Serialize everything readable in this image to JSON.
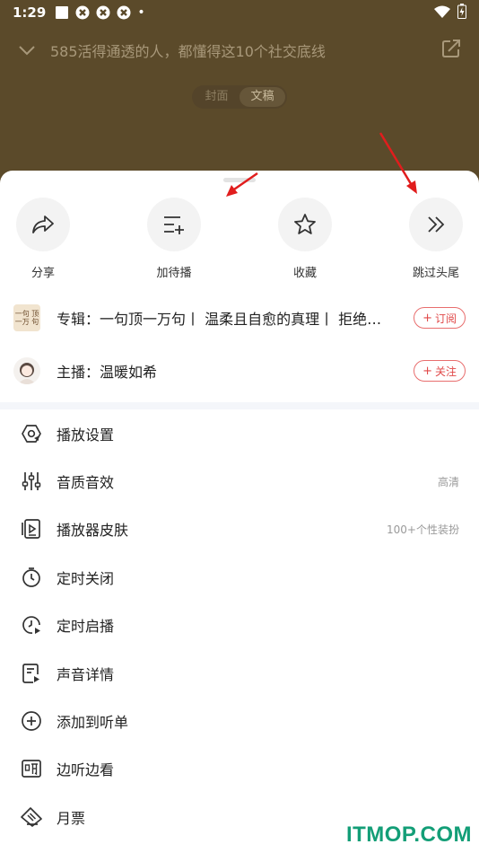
{
  "status_bar": {
    "time": "1:29",
    "dot": "•"
  },
  "header": {
    "title": "585活得通透的人，都懂得这10个社交底线",
    "tabs": [
      {
        "label": "封面"
      },
      {
        "label": "文稿"
      }
    ]
  },
  "quick_actions": [
    {
      "label": "分享",
      "icon": "share-icon"
    },
    {
      "label": "加待播",
      "icon": "add-to-queue-icon"
    },
    {
      "label": "收藏",
      "icon": "star-icon"
    },
    {
      "label": "跳过头尾",
      "icon": "skip-intro-icon"
    }
  ],
  "album": {
    "text": "专辑：一句顶一万句丨 温柔且自愈的真理丨 拒绝…",
    "thumb_text": "一句 顶一万 句",
    "button": {
      "plus": "+",
      "label": "订阅"
    }
  },
  "host": {
    "text": "主播：温暖如希",
    "button": {
      "plus": "+",
      "label": "关注"
    }
  },
  "menu": [
    {
      "label": "播放设置",
      "value": "",
      "icon": "play-settings-icon"
    },
    {
      "label": "音质音效",
      "value": "高清",
      "icon": "equalizer-icon"
    },
    {
      "label": "播放器皮肤",
      "value": "100+个性装扮",
      "icon": "player-skin-icon"
    },
    {
      "label": "定时关闭",
      "value": "",
      "icon": "timer-icon"
    },
    {
      "label": "定时启播",
      "value": "",
      "icon": "timed-start-icon"
    },
    {
      "label": "声音详情",
      "value": "",
      "icon": "audio-detail-icon"
    },
    {
      "label": "添加到听单",
      "value": "",
      "icon": "add-playlist-icon"
    },
    {
      "label": "边听边看",
      "value": "",
      "icon": "listen-read-icon"
    },
    {
      "label": "月票",
      "value": "",
      "icon": "monthly-ticket-icon"
    }
  ],
  "watermark": "ITMOP.COM",
  "colors": {
    "accent_red": "#e04848",
    "header_bg": "#5b4a2a",
    "watermark": "#139e77"
  }
}
